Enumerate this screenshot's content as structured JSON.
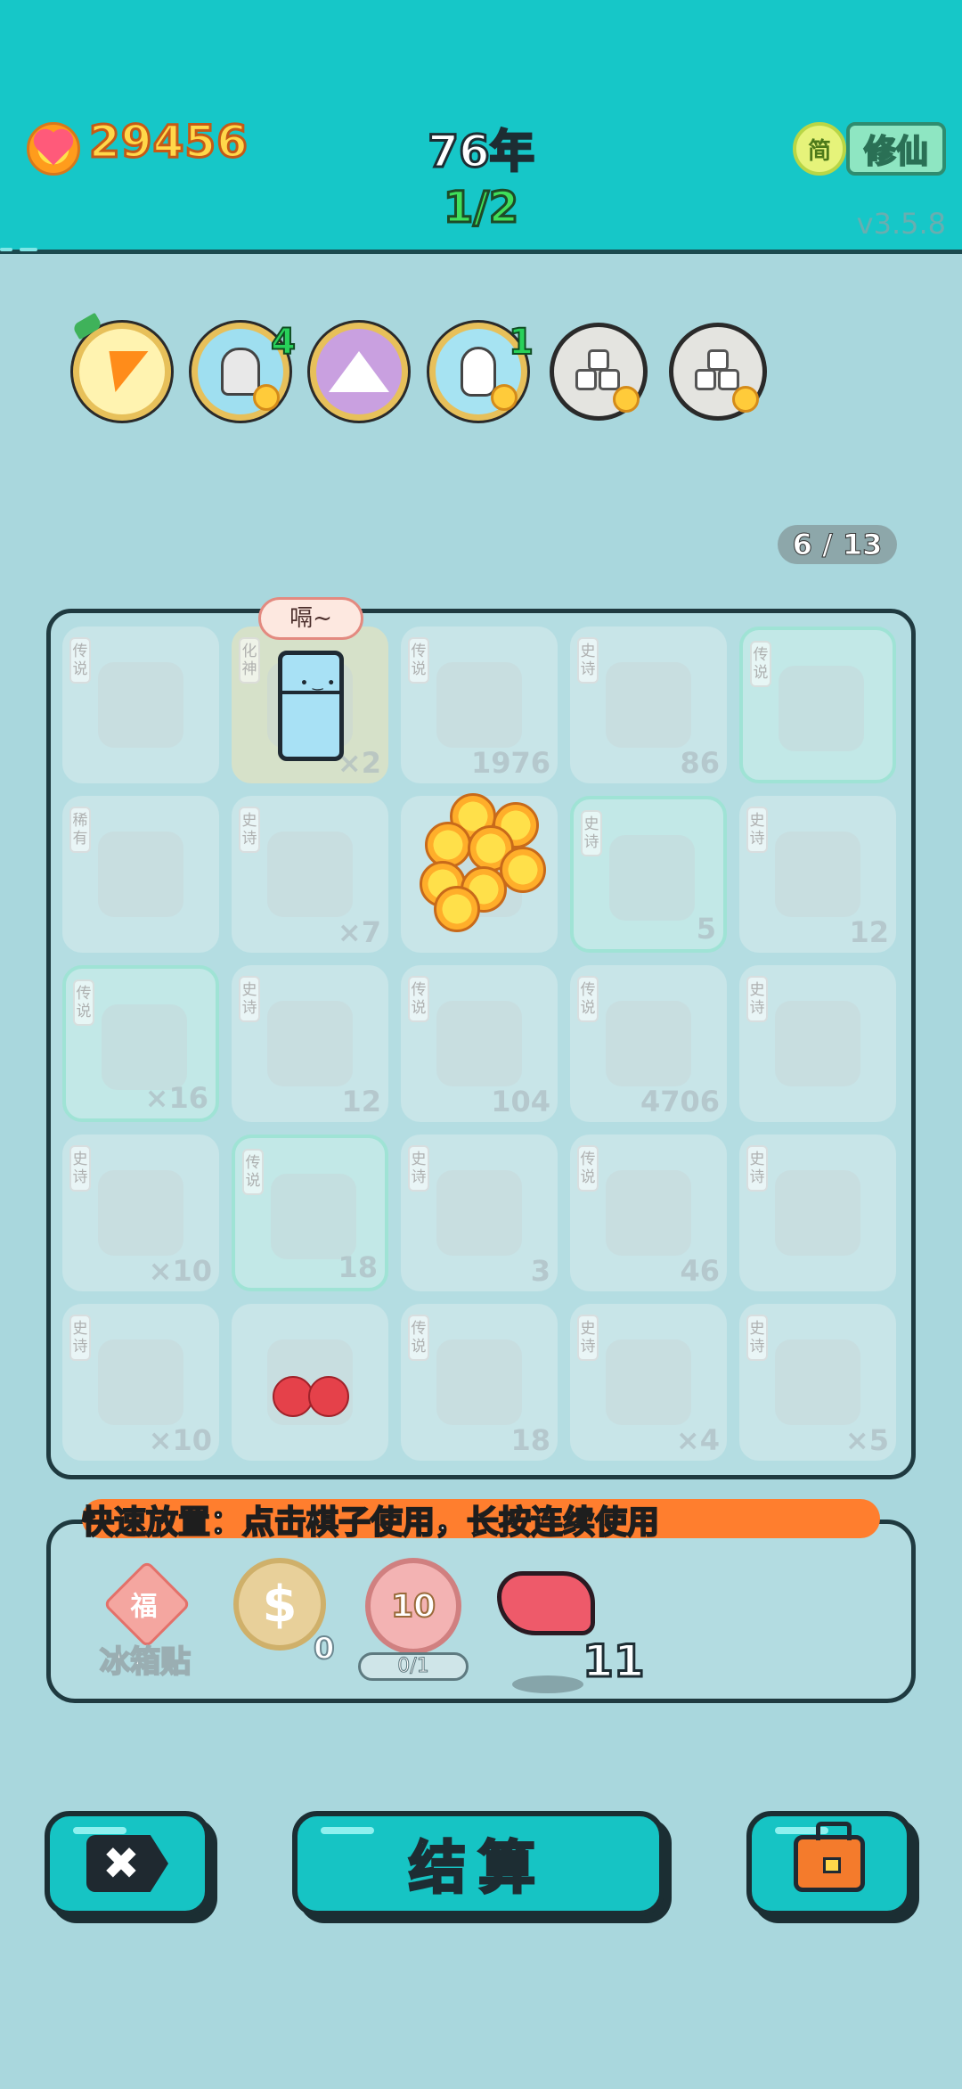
{
  "header": {
    "coins": "29456",
    "year": "76年",
    "round": "1/2",
    "lang_toggle": "简",
    "mode_button": "修仙",
    "version": "v3.5.8"
  },
  "boosters": [
    {
      "name": "lightning-booster",
      "badge": ""
    },
    {
      "name": "husky-booster",
      "badge": "4"
    },
    {
      "name": "skirt-booster",
      "badge": ""
    },
    {
      "name": "rabbit-booster",
      "badge": "1"
    },
    {
      "name": "cube-booster-1",
      "badge": ""
    },
    {
      "name": "cube-booster-2",
      "badge": ""
    }
  ],
  "pieces_counter": "6 / 13",
  "board": {
    "speech_bubble": "嗝~",
    "cells": [
      [
        {
          "tag": "传说",
          "count": ""
        },
        {
          "tag": "化神",
          "count": "×2"
        },
        {
          "tag": "传说",
          "count": "1976"
        },
        {
          "tag": "史诗",
          "count": "86"
        },
        {
          "tag": "传说",
          "count": ""
        }
      ],
      [
        {
          "tag": "稀有",
          "count": ""
        },
        {
          "tag": "史诗",
          "count": "×7"
        },
        {
          "tag": "",
          "count": ""
        },
        {
          "tag": "史诗",
          "count": "5"
        },
        {
          "tag": "史诗",
          "count": "12"
        }
      ],
      [
        {
          "tag": "传说",
          "count": "×16"
        },
        {
          "tag": "史诗",
          "count": "12"
        },
        {
          "tag": "传说",
          "count": "104"
        },
        {
          "tag": "传说",
          "count": "4706"
        },
        {
          "tag": "史诗",
          "count": ""
        }
      ],
      [
        {
          "tag": "史诗",
          "count": "×10"
        },
        {
          "tag": "传说",
          "count": "18"
        },
        {
          "tag": "史诗",
          "count": "3"
        },
        {
          "tag": "传说",
          "count": "46"
        },
        {
          "tag": "史诗",
          "count": ""
        }
      ],
      [
        {
          "tag": "史诗",
          "count": "×10"
        },
        {
          "tag": "",
          "count": ""
        },
        {
          "tag": "传说",
          "count": "18"
        },
        {
          "tag": "史诗",
          "count": "×4"
        },
        {
          "tag": "史诗",
          "count": "×5"
        }
      ]
    ]
  },
  "tray": {
    "tip": "快速放置：点击棋子使用，长按连续使用",
    "sticker_char": "福",
    "sticker_label": "冰箱贴",
    "dollar_symbol": "$",
    "dollar_count": "0",
    "bag_value": "10",
    "bag_progress": "0/1",
    "liver_count": "11"
  },
  "buttons": {
    "close": "✖",
    "settle": "结算"
  }
}
